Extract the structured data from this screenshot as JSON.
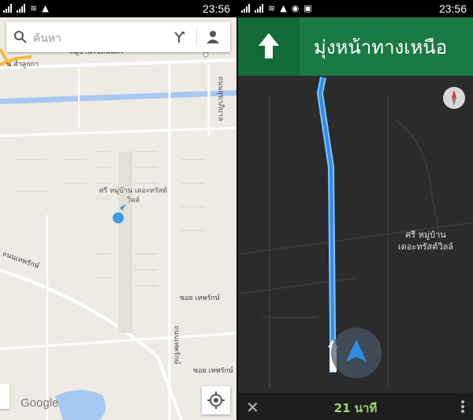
{
  "status_left": {
    "time": "23:56"
  },
  "status_right": {
    "time": "23:56"
  },
  "search": {
    "placeholder": "ค้นหา"
  },
  "map": {
    "place_label": "ศรี หมู่บ้าน เดอะทรัสต์วิลล์",
    "top_label_1": "หมู่บ้านรัชตนนทร",
    "top_label_2": "น สำลูกกา",
    "road_1": "ถนนเทพรักษ์",
    "road_2": "ซอย เทพรักษ์",
    "road_3": "ซอย เทพรักษ์",
    "road_4": "ถนนเทพรักษ์",
    "road_5": "ถนนรักษ์",
    "road_vert": "ถนนสุขาภิบาล",
    "logo": "Google"
  },
  "navigation": {
    "instruction": "มุ่งหน้าทางเหนือ",
    "place_label_1": "ศรี หมู่บ้าน",
    "place_label_2": "เดอะทรัสต์วิลล์",
    "eta": "21 นาที",
    "close": "✕"
  },
  "icons": {
    "search": "search-icon",
    "directions": "directions-icon",
    "account": "account-icon",
    "my_location": "my-location-icon",
    "compass": "compass-icon",
    "nav_arrow": "straight-arrow-icon",
    "more": "more-vert-icon"
  },
  "colors": {
    "nav_green": "#1a7a43",
    "route_blue": "#4aa8ff",
    "eta_green": "#9cd66a",
    "location_blue": "#3d9be9"
  }
}
